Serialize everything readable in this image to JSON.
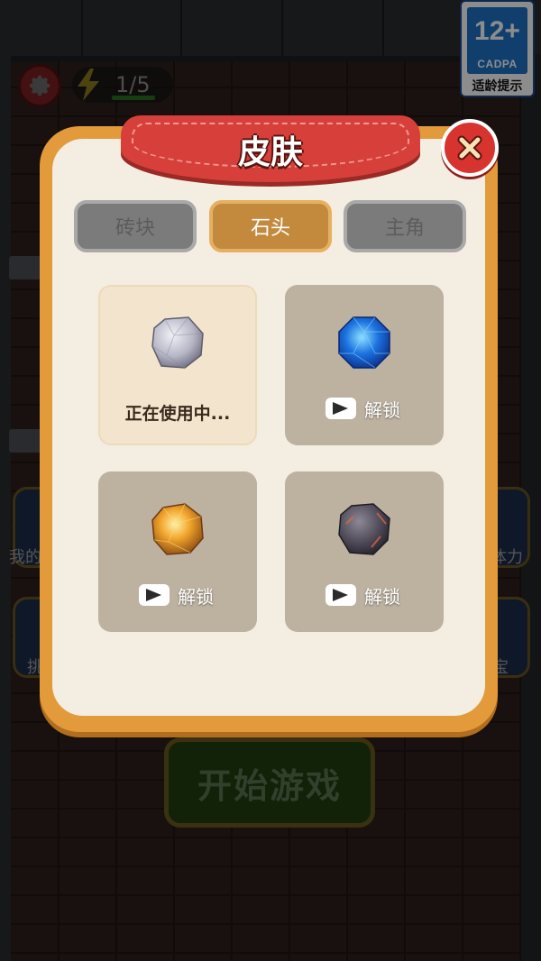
{
  "hud": {
    "energy_count": "1/5",
    "icons": {
      "settings": "gear-icon",
      "energy": "lightning-icon"
    }
  },
  "side_labels": {
    "left": "我的",
    "right": "体力",
    "left_lower": "挑",
    "right_lower": "宝"
  },
  "age_rating": {
    "age": "12+",
    "org": "CADPA",
    "hint": "适龄提示"
  },
  "start_button": {
    "label": "开始游戏"
  },
  "dialog": {
    "title": "皮肤",
    "tabs": [
      {
        "label": "砖块",
        "active": false
      },
      {
        "label": "石头",
        "active": true
      },
      {
        "label": "主角",
        "active": false
      }
    ],
    "items": [
      {
        "stone": "gray-stone",
        "status": "正在使用中...",
        "locked": false
      },
      {
        "stone": "blue-gem",
        "status": "解锁",
        "locked": true
      },
      {
        "stone": "gold-ore",
        "status": "解锁",
        "locked": true
      },
      {
        "stone": "dark-stone",
        "status": "解锁",
        "locked": true
      }
    ]
  },
  "colors": {
    "dialog_border": "#e39a3b",
    "dialog_bg": "#f4ede2",
    "ribbon": "#d7403a",
    "active_tab": "#c38a3e",
    "inactive_tab": "#7b7b7b",
    "locked_card": "#bdb1a0"
  }
}
